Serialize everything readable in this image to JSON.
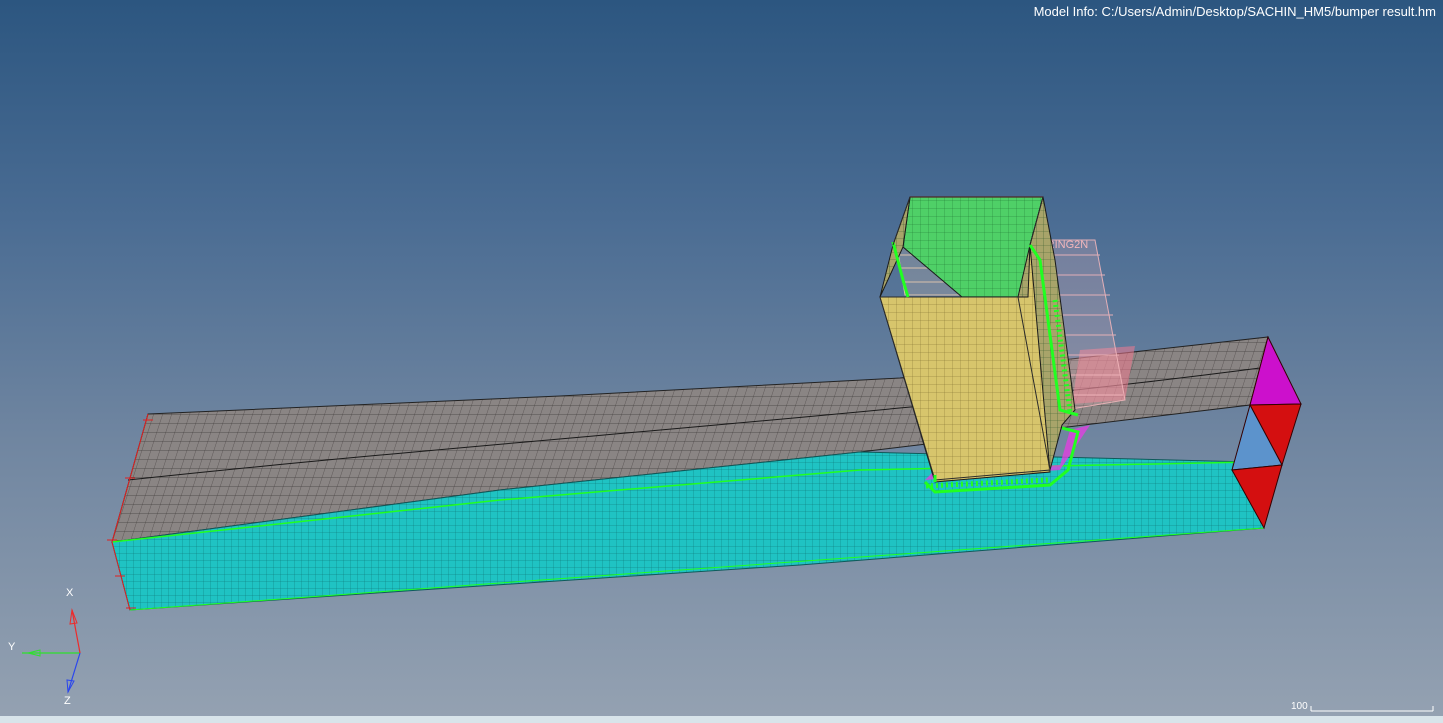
{
  "model_info": "Model Info: C:/Users/Admin/Desktop/SACHIN_HM5/bumper result.hm",
  "axes": {
    "x": "X",
    "y": "Y",
    "z": "Z"
  },
  "scale_bar": {
    "label": "100"
  },
  "spring_label": "SPRING2N",
  "colors": {
    "background_top": "#2c5680",
    "background_bottom": "#95a2b2",
    "bumper_top": "#8a8584",
    "bumper_front": "#1fc3c3",
    "crash_box_front": "#d7c56c",
    "crash_box_top": "#4fd067",
    "end_magenta": "#cc10cc",
    "end_red": "#d40f10",
    "end_blue": "#5c93cc",
    "edge_green": "#21ff21",
    "spring_pink": "#f2b6bb"
  },
  "icons": {
    "axis": "axis-triad-icon",
    "scale": "scale-bar-icon"
  }
}
